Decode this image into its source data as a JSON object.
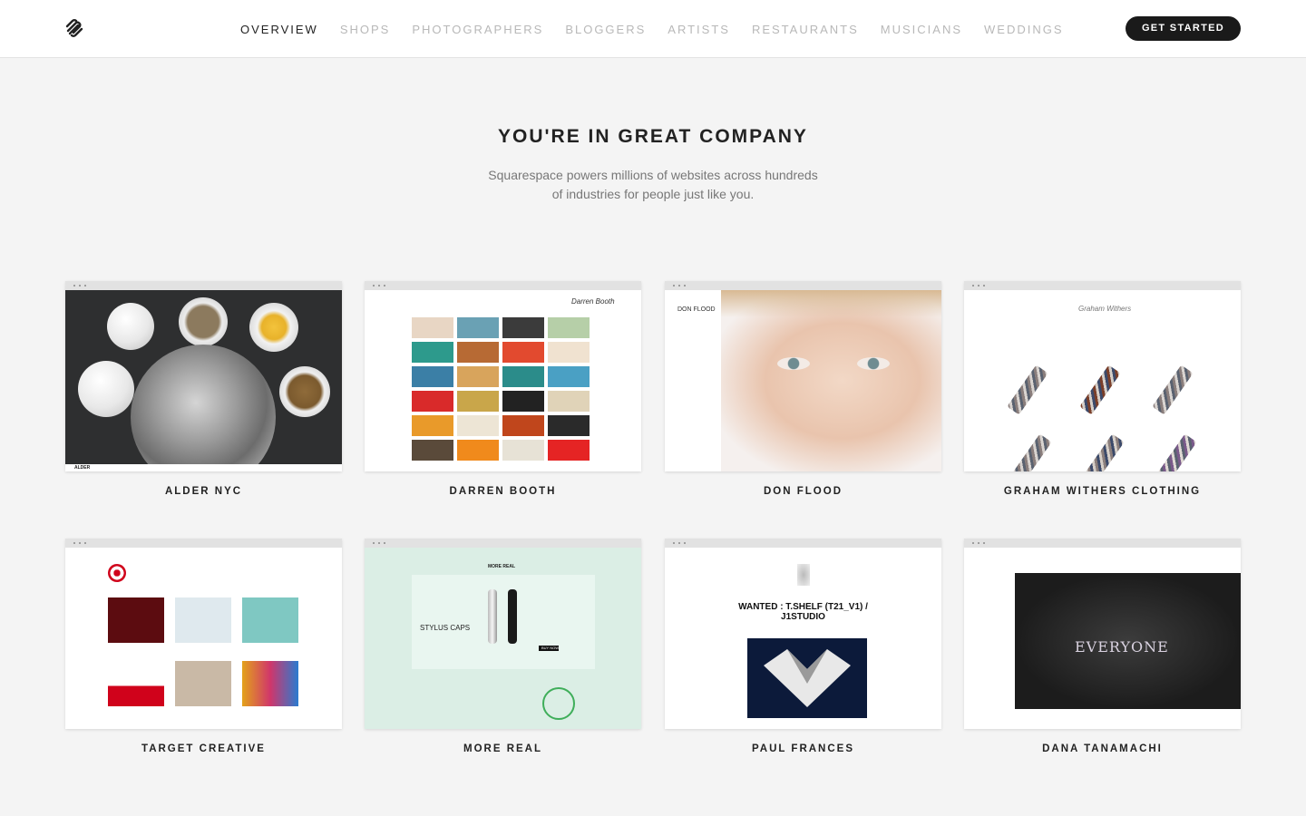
{
  "nav": {
    "items": [
      "OVERVIEW",
      "SHOPS",
      "PHOTOGRAPHERS",
      "BLOGGERS",
      "ARTISTS",
      "RESTAURANTS",
      "MUSICIANS",
      "WEDDINGS"
    ],
    "active": "OVERVIEW",
    "cta": "GET STARTED"
  },
  "hero": {
    "title": "YOU'RE IN GREAT COMPANY",
    "subtitle_line1": "Squarespace powers millions of websites across hundreds",
    "subtitle_line2": "of industries for people just like you."
  },
  "cards": [
    {
      "label": "ALDER NYC",
      "site_text": "ALDER"
    },
    {
      "label": "DARREN BOOTH",
      "site_text": "Darren Booth"
    },
    {
      "label": "DON FLOOD",
      "site_text": "DON FLOOD"
    },
    {
      "label": "GRAHAM WITHERS CLOTHING",
      "site_text": "Graham Withers"
    },
    {
      "label": "TARGET CREATIVE"
    },
    {
      "label": "MORE REAL",
      "site_text": "MORE REAL",
      "site_headline": "STYLUS CAPS",
      "site_button": "BUY NOW"
    },
    {
      "label": "PAUL FRANCES",
      "site_headline": "WANTED : T.SHELF (T21_V1) / J1STUDIO"
    },
    {
      "label": "DANA TANAMACHI",
      "site_text": "EVERYONE"
    }
  ],
  "colors": {
    "accent": "#1a1a1a",
    "nav_inactive": "#b8b8b8",
    "background": "#f4f4f4"
  }
}
